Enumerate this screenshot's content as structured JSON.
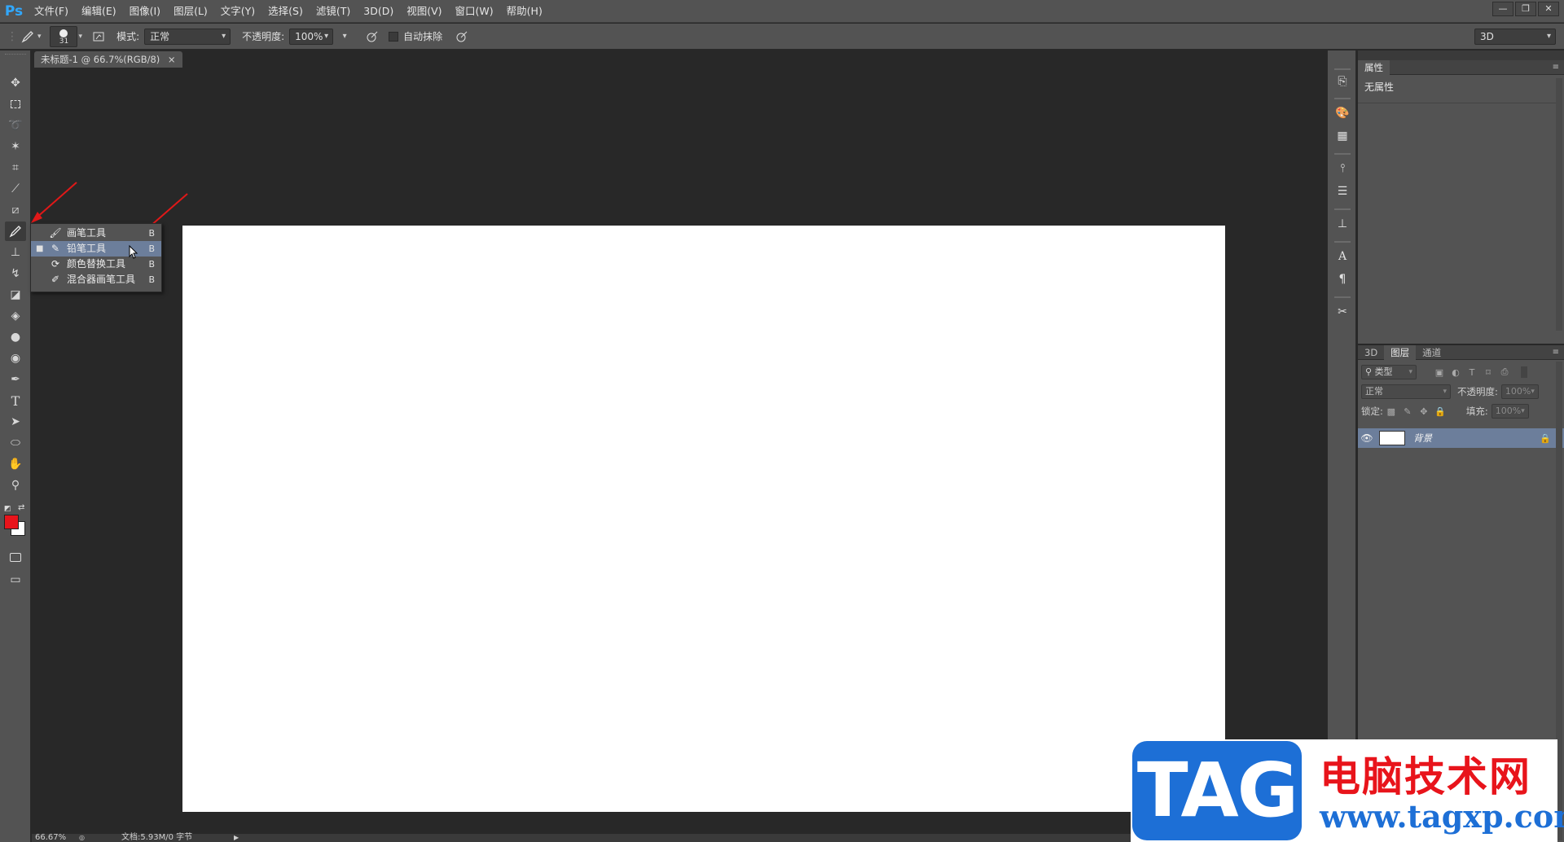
{
  "app": {
    "logo": "Ps"
  },
  "menu": [
    "文件(F)",
    "编辑(E)",
    "图像(I)",
    "图层(L)",
    "文字(Y)",
    "选择(S)",
    "滤镜(T)",
    "3D(D)",
    "视图(V)",
    "窗口(W)",
    "帮助(H)"
  ],
  "window_controls": {
    "minimize": "—",
    "restore": "❐",
    "close": "✕"
  },
  "options": {
    "brush_size": "31",
    "mode_label": "模式:",
    "mode_value": "正常",
    "opacity_label": "不透明度:",
    "opacity_value": "100%",
    "auto_erase_label": "自动抹除",
    "workspace_value": "3D"
  },
  "document": {
    "tab_title": "未标题-1 @ 66.7%(RGB/8)",
    "tab_close": "×"
  },
  "flyout": {
    "items": [
      {
        "label": "画笔工具",
        "key": "B",
        "icon": "brush-icon"
      },
      {
        "label": "铅笔工具",
        "key": "B",
        "icon": "pencil-icon",
        "selected": true
      },
      {
        "label": "颜色替换工具",
        "key": "B",
        "icon": "color-replace-icon"
      },
      {
        "label": "混合器画笔工具",
        "key": "B",
        "icon": "mixer-brush-icon"
      }
    ]
  },
  "colors": {
    "foreground": "#e8141b",
    "background": "#ffffff",
    "accent_selected": "#6c7e9b"
  },
  "status": {
    "zoom": "66.67%",
    "doc_info": "文档:5.93M/0 字节"
  },
  "properties_panel": {
    "tab": "属性",
    "content": "无属性"
  },
  "layers_panel": {
    "tabs": [
      "3D",
      "图层",
      "通道"
    ],
    "active_tab": "图层",
    "filter_label": "类型",
    "blend_mode": "正常",
    "opacity_label": "不透明度:",
    "opacity_value": "100%",
    "lock_label": "锁定:",
    "fill_label": "填充:",
    "fill_value": "100%",
    "layers": [
      {
        "name": "背景",
        "visible": true,
        "locked": true
      }
    ]
  },
  "watermark": {
    "tag": "TAG",
    "site_name": "电脑技术网",
    "url": "www.tagxp.com"
  }
}
